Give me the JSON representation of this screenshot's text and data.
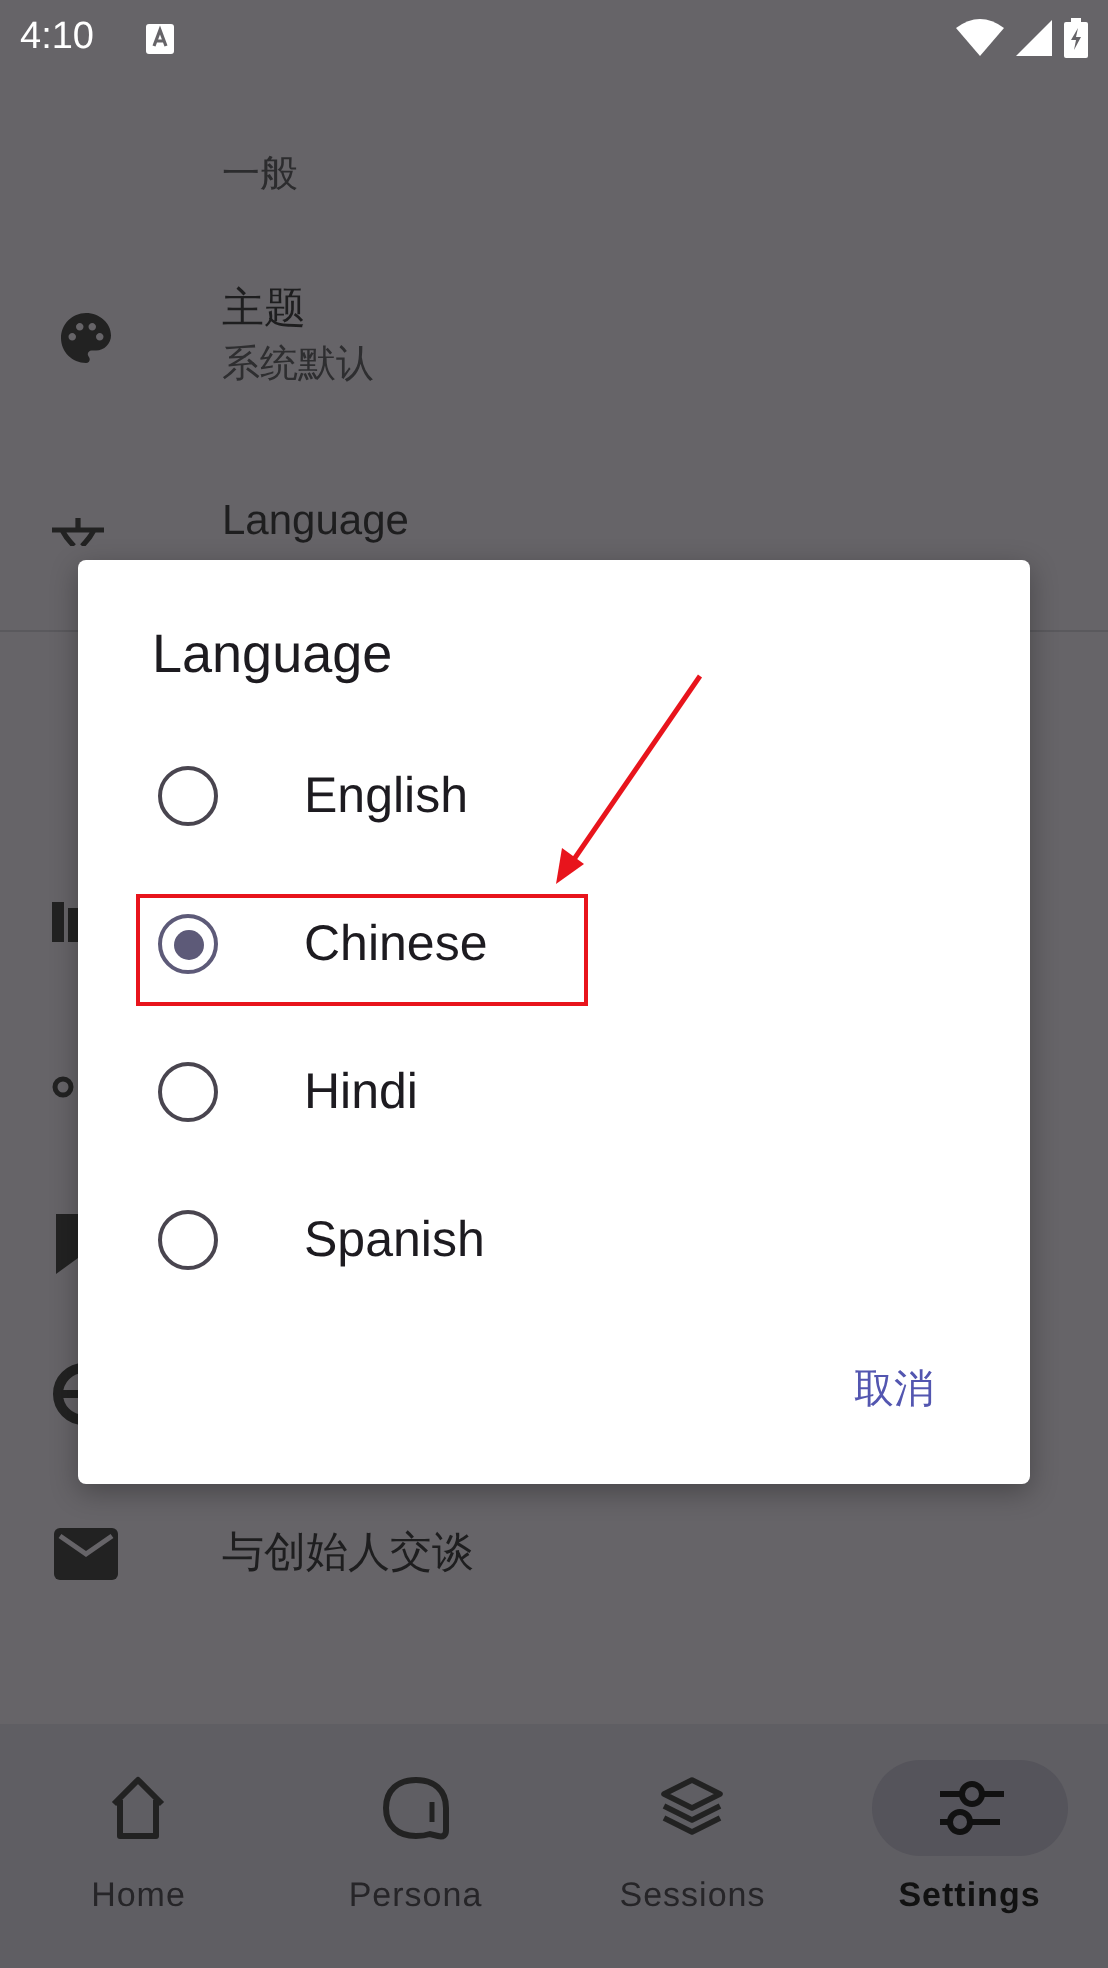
{
  "status_bar": {
    "time": "4:10"
  },
  "settings": {
    "section_header": "一般",
    "items": [
      {
        "title": "主题",
        "subtitle": "系统默认"
      },
      {
        "title": "Language"
      }
    ],
    "contact": {
      "title": "与创始人交谈"
    }
  },
  "dialog": {
    "title": "Language",
    "options": [
      {
        "label": "English",
        "selected": false
      },
      {
        "label": "Chinese",
        "selected": true
      },
      {
        "label": "Hindi",
        "selected": false
      },
      {
        "label": "Spanish",
        "selected": false
      }
    ],
    "cancel": "取消"
  },
  "nav": [
    {
      "label": "Home",
      "selected": false
    },
    {
      "label": "Persona",
      "selected": false
    },
    {
      "label": "Sessions",
      "selected": false
    },
    {
      "label": "Settings",
      "selected": true
    }
  ]
}
